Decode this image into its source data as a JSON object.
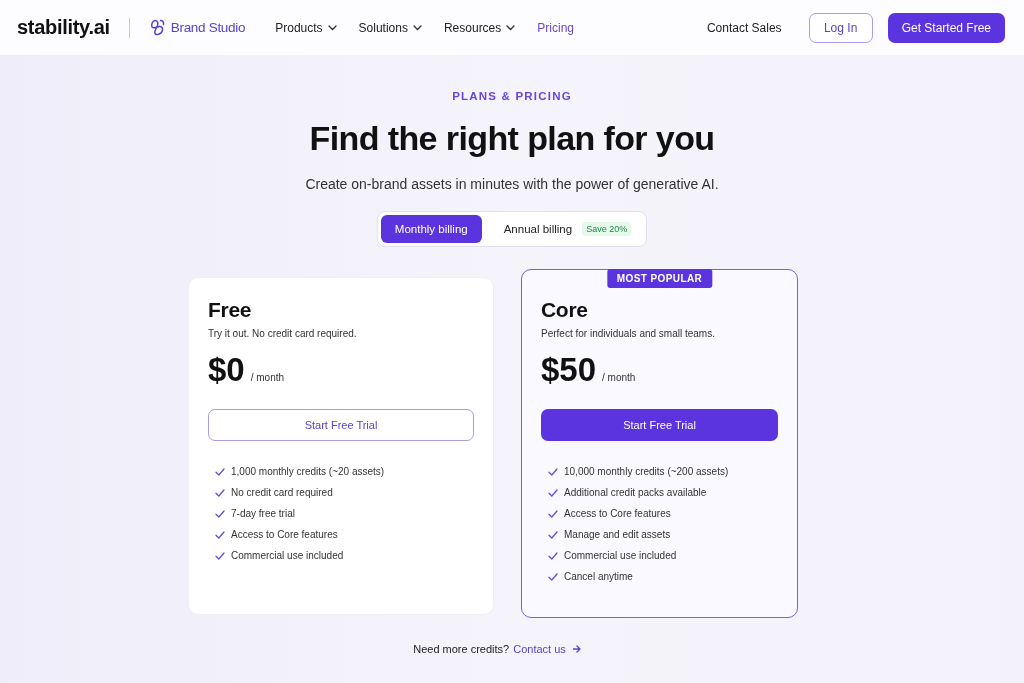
{
  "nav": {
    "logo": "stability.ai",
    "product": "Brand Studio",
    "menu": [
      {
        "label": "Products",
        "dropdown": true,
        "selected": false
      },
      {
        "label": "Solutions",
        "dropdown": true,
        "selected": false
      },
      {
        "label": "Resources",
        "dropdown": true,
        "selected": false
      },
      {
        "label": "Pricing",
        "dropdown": false,
        "selected": true
      }
    ],
    "contact": "Contact Sales",
    "login": "Log In",
    "cta": "Get Started Free"
  },
  "hero": {
    "eyebrow": "PLANS & PRICING",
    "title": "Find the right plan for you",
    "subtitle": "Create on-brand assets in minutes with the power of generative AI."
  },
  "billing_toggle": [
    {
      "label": "Monthly billing",
      "selected": true
    },
    {
      "label": "Annual billing",
      "selected": false,
      "badge": "Save 20%"
    }
  ],
  "plans": [
    {
      "name": "Free",
      "description": "Try it out. No credit card required.",
      "price": "$0",
      "period": "/ month",
      "button": "Start Free Trial",
      "featured": false,
      "features": [
        "1,000 monthly credits (~20 assets)",
        "No credit card required",
        "7-day free trial",
        "Access to Core features",
        "Commercial use included"
      ]
    },
    {
      "name": "Core",
      "badge": "MOST POPULAR",
      "description": "Perfect for individuals and small teams.",
      "price": "$50",
      "period": "/ month",
      "button": "Start Free Trial",
      "featured": true,
      "features": [
        "10,000 monthly credits (~200 assets)",
        "Additional credit packs available",
        "Access to Core features",
        "Manage and edit assets",
        "Commercial use included",
        "Cancel anytime"
      ]
    }
  ],
  "footer": {
    "text": "Need more credits?",
    "link": "Contact us"
  }
}
